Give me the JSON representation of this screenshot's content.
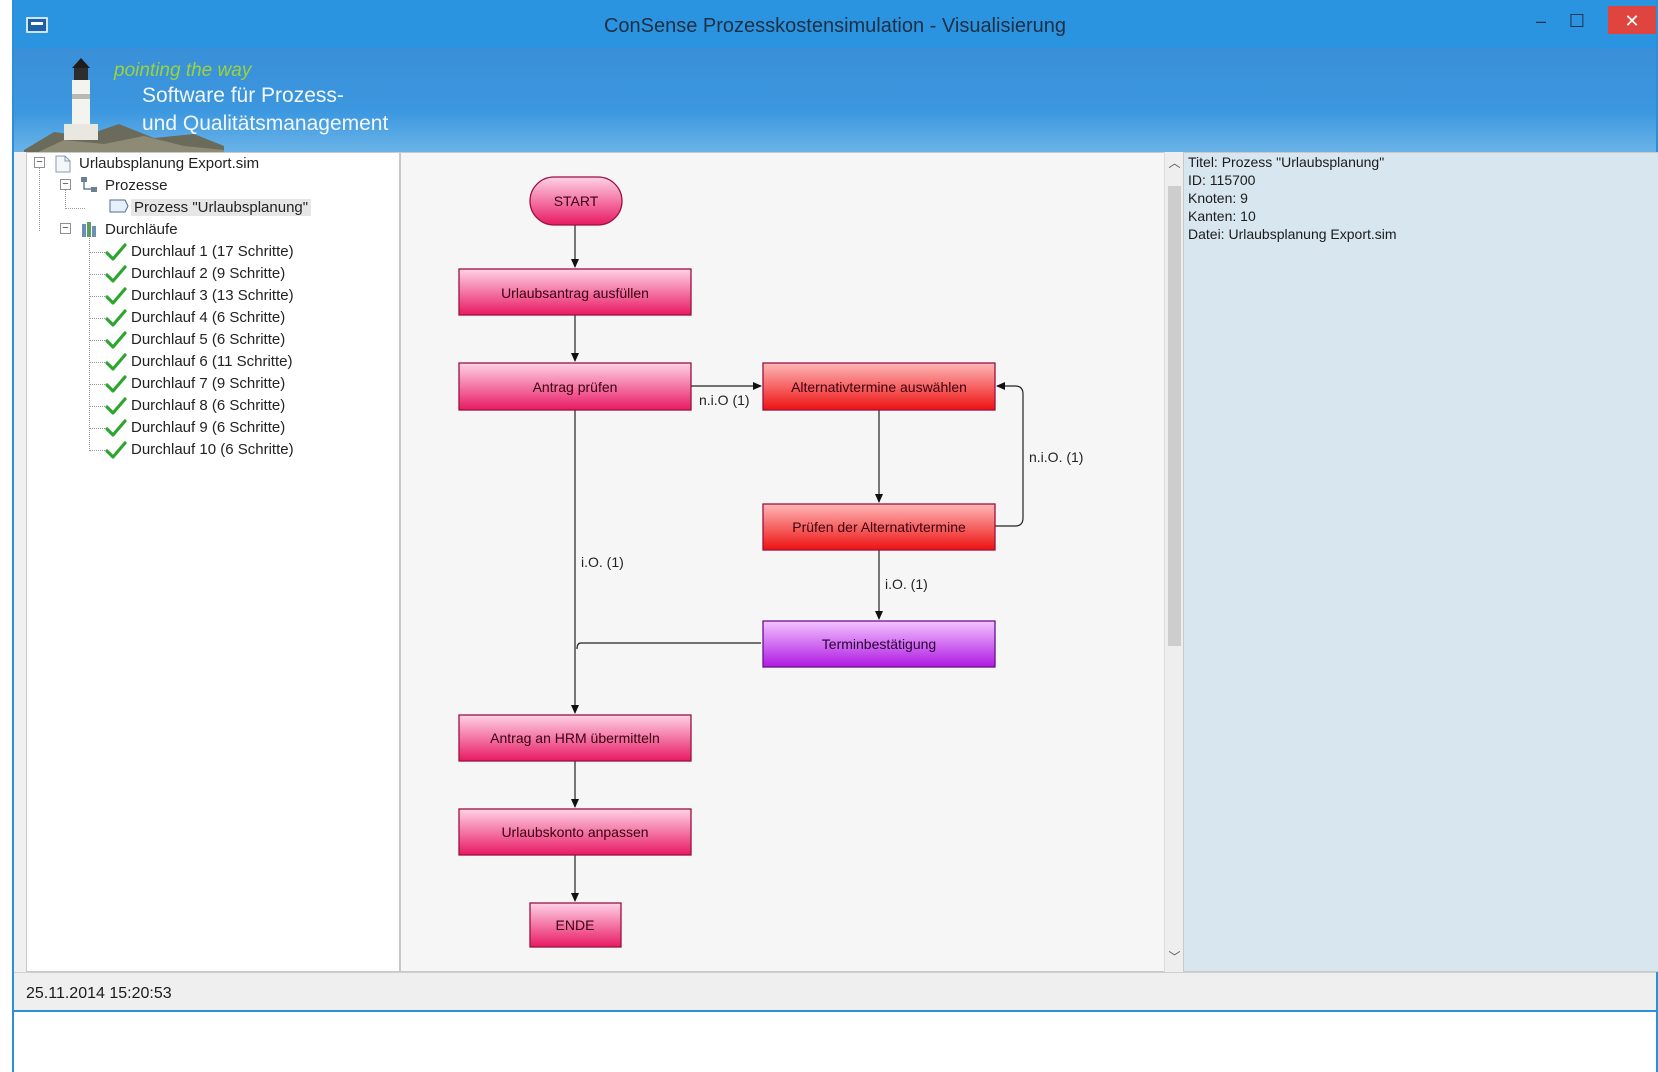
{
  "window": {
    "title": "ConSense Prozesskostensimulation - Visualisierung",
    "controls": {
      "minimize": "–",
      "maximize": "☐",
      "close": "✕"
    }
  },
  "banner": {
    "slogan": "pointing the way",
    "line1": "Software für Prozess-",
    "line2": "und Qualitätsmanagement"
  },
  "tree": {
    "root": "Urlaubsplanung Export.sim",
    "processes_label": "Prozesse",
    "process_item": "Prozess \"Urlaubsplanung\"",
    "runs_label": "Durchläufe",
    "runs": [
      "Durchlauf 1 (17 Schritte)",
      "Durchlauf 2 (9 Schritte)",
      "Durchlauf 3 (13 Schritte)",
      "Durchlauf 4 (6 Schritte)",
      "Durchlauf 5 (6 Schritte)",
      "Durchlauf 6 (11 Schritte)",
      "Durchlauf 7 (9 Schritte)",
      "Durchlauf 8 (6 Schritte)",
      "Durchlauf 9 (6 Schritte)",
      "Durchlauf 10 (6 Schritte)"
    ]
  },
  "diagram": {
    "nodes": {
      "start": "START",
      "fill_request": "Urlaubsantrag ausfüllen",
      "check_request": "Antrag prüfen",
      "select_alternatives": "Alternativtermine auswählen",
      "check_alternatives": "Prüfen der Alternativtermine",
      "confirmation": "Terminbestätigung",
      "send_hrm": "Antrag an HRM übermitteln",
      "adjust_account": "Urlaubskonto anpassen",
      "end": "ENDE"
    },
    "edge_labels": {
      "check_to_alt": "n.i.O (1)",
      "check_to_hrm": "i.O. (1)",
      "alt_loop": "n.i.O. (1)",
      "alt_to_confirm": "i.O. (1)"
    },
    "colors": {
      "task_top": "#ffd2e6",
      "task_bottom": "#e81a62",
      "alert_top": "#ffb7b7",
      "alert_bottom": "#ee1111",
      "purple_top": "#f3c4ff",
      "purple_bottom": "#b019e3",
      "border": "#9a1140"
    }
  },
  "info": {
    "lines": [
      "Titel: Prozess \"Urlaubsplanung\"",
      "ID: 115700",
      "Knoten: 9",
      "Kanten: 10",
      "Datei: Urlaubsplanung Export.sim"
    ]
  },
  "status": {
    "text": "25.11.2014   15:20:53"
  }
}
